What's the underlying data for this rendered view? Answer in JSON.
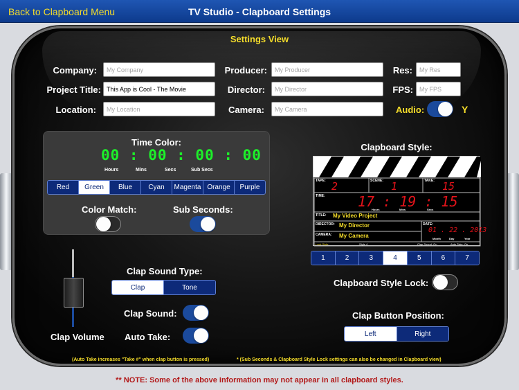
{
  "navbar": {
    "back_label": "Back to Clapboard Menu",
    "title": "TV Studio - Clapboard Settings"
  },
  "settings_title": "Settings View",
  "fields": {
    "company": {
      "label": "Company:",
      "placeholder": "My Company",
      "value": ""
    },
    "project_title": {
      "label": "Project Title:",
      "placeholder": "",
      "value": "This App is Cool - The Movie"
    },
    "location": {
      "label": "Location:",
      "placeholder": "My Location",
      "value": ""
    },
    "producer": {
      "label": "Producer:",
      "placeholder": "My Producer",
      "value": ""
    },
    "director": {
      "label": "Director:",
      "placeholder": "My Director",
      "value": ""
    },
    "camera": {
      "label": "Camera:",
      "placeholder": "My Camera",
      "value": ""
    },
    "res": {
      "label": "Res:",
      "placeholder": "My Res",
      "value": ""
    },
    "fps": {
      "label": "FPS:",
      "placeholder": "My FPS",
      "value": ""
    }
  },
  "audio": {
    "label": "Audio:",
    "on": true,
    "indicator": "Y"
  },
  "time_color": {
    "label": "Time Color:",
    "display": "00 : 00 : 00 : 00",
    "units": [
      "Hours",
      "Mins",
      "Secs",
      "Sub Secs"
    ],
    "colors": [
      "Red",
      "Green",
      "Blue",
      "Cyan",
      "Magenta",
      "Orange",
      "Purple"
    ],
    "selected": "Green",
    "digit_color": "#1df02a"
  },
  "color_match": {
    "label": "Color Match:",
    "on": false
  },
  "sub_seconds": {
    "label": "Sub Seconds:",
    "on": true
  },
  "clap_volume": {
    "label": "Clap Volume"
  },
  "clap_sound_type": {
    "label": "Clap Sound Type:",
    "options": [
      "Clap",
      "Tone"
    ],
    "selected": "Clap"
  },
  "clap_sound": {
    "label": "Clap Sound:",
    "on": true
  },
  "auto_take": {
    "label": "Auto Take:",
    "on": true
  },
  "clapboard_style": {
    "label": "Clapboard Style:",
    "options": [
      "1",
      "2",
      "3",
      "4",
      "5",
      "6",
      "7"
    ],
    "selected": "4",
    "preview": {
      "tape_label": "TAPE:",
      "tape": "2",
      "scene_label": "SCENE:",
      "scene": "1",
      "take_label": "TAKE:",
      "take": "15",
      "time_label": "TIME:",
      "time": "17 : 19 : 15",
      "time_units": [
        "Hours",
        "Mins",
        "Secs"
      ],
      "title_label": "TITLE:",
      "title": "My Video Project",
      "director_label": "DIRECTOR:",
      "director": "My Director",
      "camera_label": "CAMERA:",
      "camera": "My Camera",
      "date_label": "DATE:",
      "date": "01 . 22 . 2013",
      "date_units": [
        "Month",
        "Day",
        "Year"
      ],
      "footer_left": "Lock Style:",
      "footer_mid": "Style 4",
      "footer_right1": "Clap Sound: On",
      "footer_right2": "Auto Take: On"
    }
  },
  "clapboard_style_lock": {
    "label": "Clapboard Style Lock:",
    "on": false
  },
  "clap_button_position": {
    "label": "Clap Button Position:",
    "options": [
      "Left",
      "Right"
    ],
    "selected": "Left"
  },
  "notes": {
    "auto_take": "(Auto Take increases \"Take #\" when clap button is pressed)",
    "sub_seconds": "* (Sub Seconds & Clapboard Style Lock settings can also be changed in Clapboard view)",
    "warning": "** NOTE:  Some of the above information may not appear in all clapboard styles."
  },
  "colors": {
    "accent_yellow": "#f5dd2a",
    "nav_blue": "#1f56b3",
    "toggle_on": "#1b4a9c",
    "warning_red": "#b21818"
  }
}
